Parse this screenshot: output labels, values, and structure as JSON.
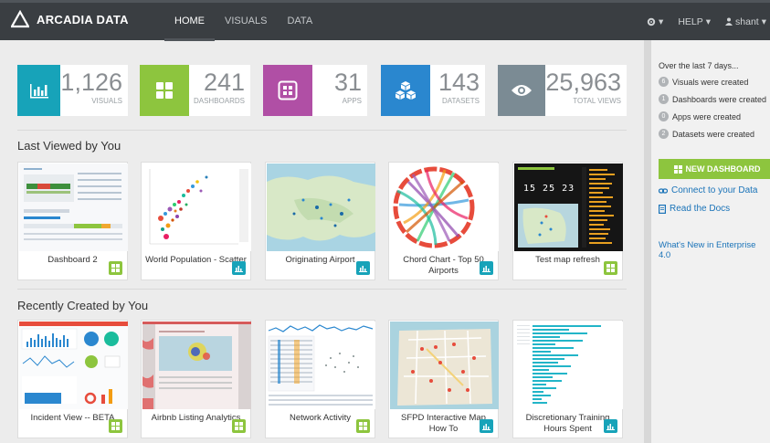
{
  "brand": {
    "name": "ARCADIA DATA"
  },
  "nav": [
    {
      "label": "HOME",
      "active": true
    },
    {
      "label": "VISUALS",
      "active": false
    },
    {
      "label": "DATA",
      "active": false
    }
  ],
  "topright": {
    "settings_icon": "gear-icon",
    "help_label": "HELP",
    "user_label": "shant"
  },
  "stats": [
    {
      "value": "1,126",
      "label": "VISUALS",
      "color": "#17a3b9",
      "icon": "bar-chart-icon"
    },
    {
      "value": "241",
      "label": "DASHBOARDS",
      "color": "#8dc53e",
      "icon": "grid-icon"
    },
    {
      "value": "31",
      "label": "APPS",
      "color": "#b04fa5",
      "icon": "app-icon"
    },
    {
      "value": "143",
      "label": "DATASETS",
      "color": "#2a87cf",
      "icon": "cubes-icon"
    },
    {
      "value": "25,963",
      "label": "TOTAL VIEWS",
      "color": "#7b8b94",
      "icon": "eye-icon"
    }
  ],
  "sections": {
    "last_viewed": "Last Viewed by You",
    "recent": "Recently Created by You"
  },
  "last_viewed": [
    {
      "title": "Dashboard 2",
      "type": "dashboard"
    },
    {
      "title": "World Population - Scatter",
      "type": "visual"
    },
    {
      "title": "Originating Airport",
      "type": "visual"
    },
    {
      "title": "Chord Chart - Top 50 Airports",
      "type": "visual"
    },
    {
      "title": "Test map refresh",
      "type": "dashboard"
    }
  ],
  "recent": [
    {
      "title": "Incident View -- BETA",
      "type": "dashboard"
    },
    {
      "title": "Airbnb Listing Analytics",
      "type": "dashboard"
    },
    {
      "title": "Network Activity",
      "type": "dashboard"
    },
    {
      "title": "SFPD Interactive Map How To",
      "type": "visual"
    },
    {
      "title": "Discretionary Training Hours Spent",
      "type": "visual"
    }
  ],
  "map_time": "15 25 23",
  "sidebar": {
    "heading": "Over the last 7 days...",
    "rows": [
      {
        "count": "6",
        "text": "Visuals were created"
      },
      {
        "count": "1",
        "text": "Dashboards were created"
      },
      {
        "count": "0",
        "text": "Apps were created"
      },
      {
        "count": "2",
        "text": "Datasets were created"
      }
    ],
    "new_dashboard": "NEW DASHBOARD",
    "connect": "Connect to your Data",
    "docs": "Read the Docs",
    "whats_new": "What's New in Enterprise 4.0"
  },
  "colors": {
    "visual_badge": "#17a3b9",
    "dashboard_badge": "#8dc53e",
    "link": "#1a73b8"
  }
}
